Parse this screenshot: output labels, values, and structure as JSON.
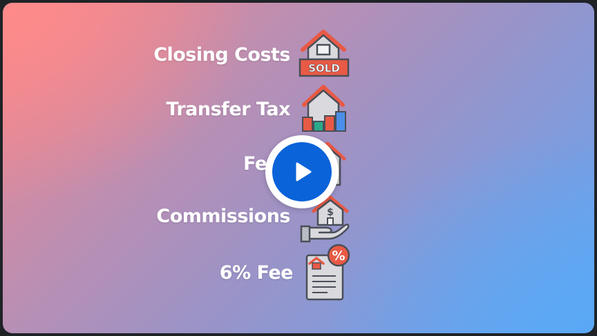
{
  "slide": {
    "items": [
      {
        "label": "Closing Costs",
        "icon": "sold-house-icon"
      },
      {
        "label": "Transfer Tax",
        "icon": "house-chart-icon"
      },
      {
        "label": "Fees",
        "icon": "house-document-icon"
      },
      {
        "label": "Commissions",
        "icon": "hand-house-dollar-icon"
      },
      {
        "label": "6% Fee",
        "icon": "percent-document-icon"
      }
    ],
    "sold_sign": "SOLD"
  },
  "player": {
    "play_icon": "play-icon",
    "accent": "#0b63d9"
  },
  "colors": {
    "gradient_top_left": "#ff8a8a",
    "gradient_bottom_right": "#5aa8f5",
    "icon_red": "#e85a45",
    "icon_outline": "#4a4e57"
  }
}
